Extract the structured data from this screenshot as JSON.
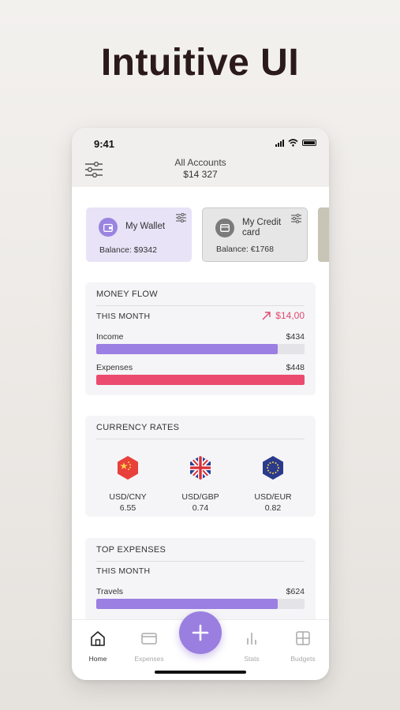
{
  "headline": "Intuitive UI",
  "status_bar": {
    "time": "9:41"
  },
  "header": {
    "title": "All Accounts",
    "total": "$14 327"
  },
  "accounts": [
    {
      "name": "My Wallet",
      "balance": "Balance: $9342",
      "icon": "wallet-icon"
    },
    {
      "name": "My Credit card",
      "balance": "Balance: €1768",
      "icon": "credit-card-icon"
    }
  ],
  "money_flow": {
    "title": "MONEY FLOW",
    "period": "THIS MONTH",
    "delta": "$14,00",
    "rows": [
      {
        "label": "Income",
        "value": "$434",
        "fill": 0.87,
        "color": "#9b7fe2"
      },
      {
        "label": "Expenses",
        "value": "$448",
        "fill": 1.0,
        "color": "#ec4b70"
      }
    ]
  },
  "currency_rates": {
    "title": "CURRENCY RATES",
    "rates": [
      {
        "pair": "USD/CNY",
        "value": "6.55",
        "flag": "china-flag-icon"
      },
      {
        "pair": "USD/GBP",
        "value": "0.74",
        "flag": "uk-flag-icon"
      },
      {
        "pair": "USD/EUR",
        "value": "0.82",
        "flag": "eu-flag-icon"
      }
    ]
  },
  "top_expenses": {
    "title": "TOP EXPENSES",
    "period": "THIS MONTH",
    "rows": [
      {
        "label": "Travels",
        "value": "$624",
        "fill": 0.87,
        "color": "#9b7fe2"
      }
    ]
  },
  "bottom_nav": {
    "items": [
      {
        "label": "Home",
        "icon": "home-icon",
        "active": true
      },
      {
        "label": "Expenses",
        "icon": "card-icon",
        "active": false
      },
      {
        "label": "Stats",
        "icon": "stats-icon",
        "active": false
      },
      {
        "label": "Budgets",
        "icon": "grid-icon",
        "active": false
      }
    ],
    "fab_icon": "plus-icon"
  },
  "colors": {
    "accent": "#9a7fe0",
    "negative": "#ec4b70",
    "wallet_card": "#e8e3f7"
  }
}
